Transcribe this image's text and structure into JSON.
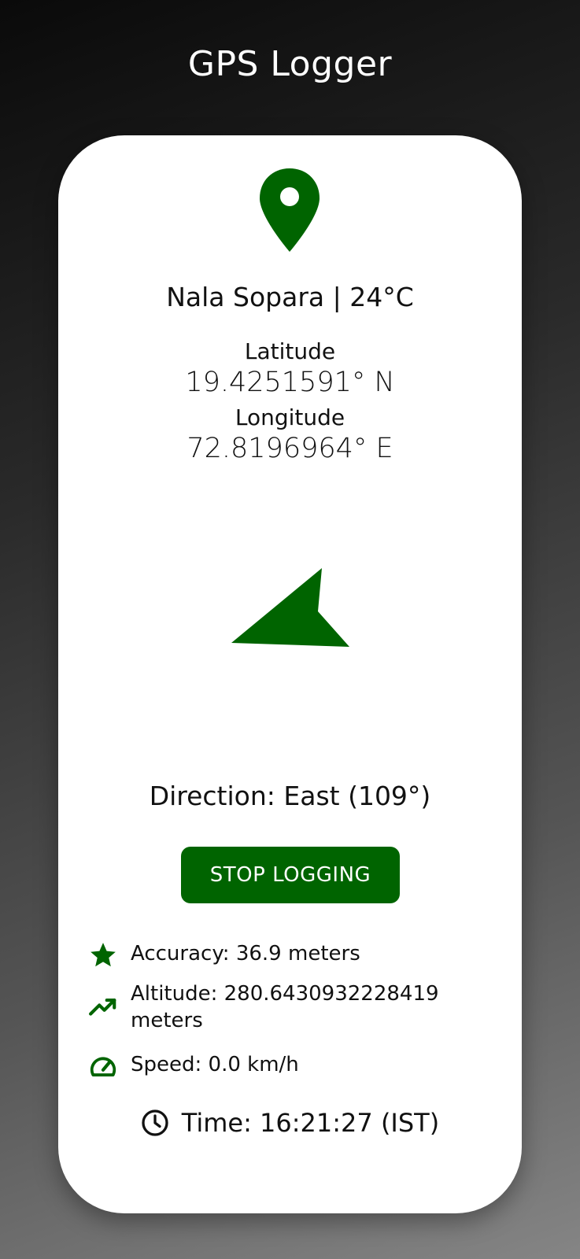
{
  "app": {
    "title": "GPS Logger"
  },
  "location": {
    "summary": "Nala Sopara | 24°C",
    "latitude_label": "Latitude",
    "latitude_value": "19.4251591° N",
    "longitude_label": "Longitude",
    "longitude_value": "72.8196964° E"
  },
  "direction": {
    "text": "Direction: East (109°)",
    "heading_degrees": 109
  },
  "controls": {
    "stop_label": "STOP LOGGING"
  },
  "stats": {
    "accuracy": "Accuracy: 36.9 meters",
    "altitude_line1": "Altitude: 280.6430932228419",
    "altitude_line2": "meters",
    "speed": "Speed: 0.0 km/h"
  },
  "time": {
    "text": "Time: 16:21:27 (IST)"
  },
  "colors": {
    "accent": "#006400",
    "card": "#ffffff",
    "title_text": "#ffffff"
  },
  "icons": {
    "location": "location-pin-icon",
    "direction": "direction-arrow-icon",
    "accuracy": "star-icon",
    "altitude": "trending-up-icon",
    "speed": "speedometer-icon",
    "time": "clock-icon"
  }
}
